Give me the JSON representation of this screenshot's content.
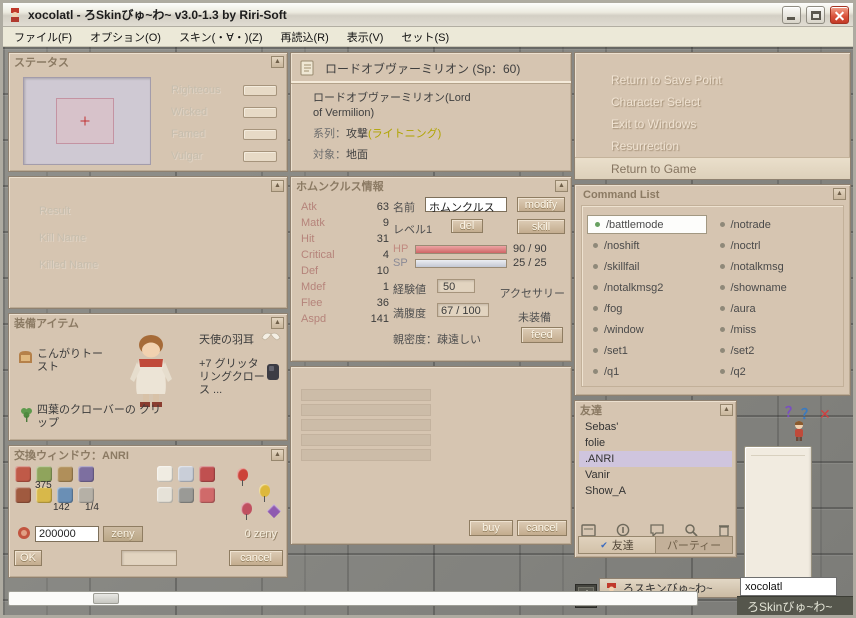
{
  "window": {
    "title": "xocolatl - ろSkinびゅ~わ~ v3.0-1.3 by Riri-Soft"
  },
  "menu_bar": {
    "items": [
      "ファイル(F)",
      "オプション(O)",
      "スキン(・∀・)(Z)",
      "再読込(R)",
      "表示(V)",
      "セット(S)"
    ]
  },
  "icons": {
    "collapse": "▲",
    "check": "✔"
  },
  "status_panel": {
    "title": "ステータス",
    "labels": [
      "Righteous",
      "Wicked",
      "Famed",
      "Vulgar"
    ]
  },
  "result_panel": {
    "labels": [
      "Result",
      "Kill Name",
      "Killed Name"
    ]
  },
  "equipment_panel": {
    "title": "装備アイテム",
    "left_item": "こんがりトースト",
    "right_item_1": "天使の羽耳",
    "right_item_2": "+7 グリッタリングクロース ...",
    "bottom_item": "四葉のクローバーの クリップ"
  },
  "trade_panel": {
    "title": "交換ウィンドウ：ANRI",
    "count_1": "375",
    "count_2": "142",
    "count_3": "1/4",
    "amount": "200000",
    "zeny_label": "zeny",
    "right_amount": "0 zeny",
    "ok_label": "OK",
    "cancel_label": "cancel"
  },
  "skill_panel": {
    "title": "ロードオブヴァーミリオン (Sp：60)",
    "name": "ロードオブヴァーミリオン(Lord of Vermilion)",
    "series_label": "系列：",
    "series_value": "攻撃",
    "series_note": "(ライトニング)",
    "target_label": "対象：",
    "target_value": "地面"
  },
  "homunculus_panel": {
    "title": "ホムンクルス情報",
    "stats": [
      {
        "label": "Atk",
        "value": "63"
      },
      {
        "label": "Matk",
        "value": "9"
      },
      {
        "label": "Hit",
        "value": "31"
      },
      {
        "label": "Critical",
        "value": "4"
      },
      {
        "label": "Def",
        "value": "10"
      },
      {
        "label": "Mdef",
        "value": "1"
      },
      {
        "label": "Flee",
        "value": "36"
      },
      {
        "label": "Aspd",
        "value": "141"
      }
    ],
    "name_label": "名前",
    "name_value": "ホムンクルス",
    "modify_label": "modify",
    "level": "レベル1",
    "del_label": "del",
    "skill_label": "skill",
    "hp_label": "HP",
    "hp_value": "90 / 90",
    "sp_label": "SP",
    "sp_value": "25 / 25",
    "exp_label": "経験値",
    "exp_value": "50",
    "accessory_label": "アクセサリー",
    "hunger_label": "満腹度",
    "hunger_value": "67 / 100",
    "unequipped_label": "未装備",
    "intimacy": "親密度：疎遠しい",
    "feed_label": "feed"
  },
  "deal_panel": {
    "buy_label": "buy",
    "cancel_label": "cancel"
  },
  "game_menu": {
    "items": [
      "Return to Save Point",
      "Character Select",
      "Exit to Windows",
      "Resurrection",
      "Return to Game"
    ]
  },
  "command_list": {
    "title": "Command List",
    "left": [
      "/battlemode",
      "/noshift",
      "/skillfail",
      "/notalkmsg2",
      "/fog",
      "/window",
      "/set1",
      "/q1"
    ],
    "right": [
      "/notrade",
      "/noctrl",
      "/notalkmsg",
      "/showname",
      "/aura",
      "/miss",
      "/set2",
      "/q2"
    ]
  },
  "friends_panel": {
    "title": "友達",
    "names": [
      "Sebas'",
      "folie",
      ".ANRI",
      "Vanir",
      "Show_A"
    ],
    "tab_left": "友達",
    "tab_right": "パーティー"
  },
  "emotes": {
    "items": [
      "？",
      "？",
      "✕"
    ]
  },
  "taskbar": {
    "input_value": "xocolatl",
    "skin_button": "ろスキンびゅ~わ~",
    "skin_label": "ろSkinびゅ~わ~"
  }
}
